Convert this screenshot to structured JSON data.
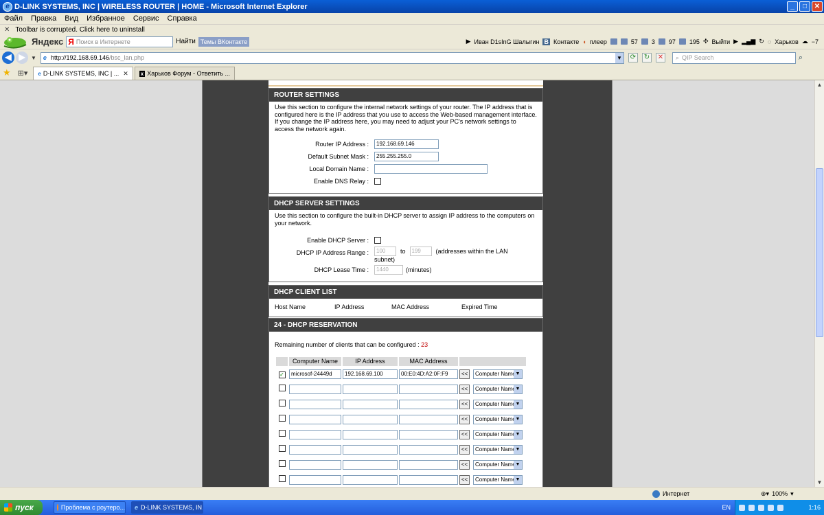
{
  "window": {
    "title": "D-LINK SYSTEMS, INC | WIRELESS ROUTER | HOME - Microsoft Internet Explorer",
    "min": "_",
    "max": "□",
    "close": "✕"
  },
  "menu": [
    "Файл",
    "Правка",
    "Вид",
    "Избранное",
    "Сервис",
    "Справка"
  ],
  "notice": {
    "close": "✕",
    "text": "Toolbar is corrupted. Click here to uninstall"
  },
  "yandex": {
    "brand": "Яндекс",
    "search_placeholder": "Поиск в Интернете",
    "find_label": "Найти",
    "vk_topics": "Темы ВКонтакте",
    "user": "Иван D1sInG Шалыгин",
    "vk_label": "Контакте",
    "player": "плеер",
    "count1": "57",
    "count2": "3",
    "count3": "97",
    "count4": "195",
    "exit": "Выйти",
    "city": "Харьков",
    "temp": "−7"
  },
  "address": {
    "host": "http://192.168.69.146",
    "path": "/bsc_lan.php",
    "qip_placeholder": "QIP Search"
  },
  "tabs": [
    {
      "label": "D-LINK SYSTEMS, INC | ...",
      "active": true
    },
    {
      "label": "Харьков Форум - Ответить ...",
      "active": false
    }
  ],
  "router": {
    "heading": "ROUTER SETTINGS",
    "desc": "Use this section to configure the internal network settings of your router. The IP address that is configured here is the IP address that you use to access the Web-based management interface. If you change the IP address here, you may need to adjust your PC's network settings to access the network again.",
    "ip_label": "Router IP Address :",
    "ip_value": "192.168.69.146",
    "mask_label": "Default Subnet Mask :",
    "mask_value": "255.255.255.0",
    "domain_label": "Local Domain Name :",
    "domain_value": "",
    "dns_label": "Enable DNS Relay :",
    "dns_checked": false
  },
  "dhcp": {
    "heading": "DHCP SERVER SETTINGS",
    "desc": "Use this section to configure the built-in DHCP server to assign IP address to the computers on your network.",
    "enable_label": "Enable DHCP Server :",
    "range_label": "DHCP IP Address Range :",
    "range_from": "100",
    "range_to_word": "to",
    "range_to": "199",
    "range_note": "(addresses within the LAN",
    "range_note2": "subnet)",
    "lease_label": "DHCP Lease Time :",
    "lease_value": "1440",
    "lease_unit": "(minutes)"
  },
  "clients": {
    "heading": "DHCP CLIENT LIST",
    "columns": [
      "Host Name",
      "IP Address",
      "MAC Address",
      "Expired Time"
    ]
  },
  "reservation": {
    "heading": "24 - DHCP RESERVATION",
    "remaining_label": "Remaining number of clients that can be configured :",
    "remaining_value": "23",
    "columns": [
      "Computer Name",
      "IP Address",
      "MAC Address"
    ],
    "copy_btn": "<<",
    "select_value": "Computer Name",
    "rows": [
      {
        "checked": true,
        "name": "microsof-24449d",
        "ip": "192.168.69.100",
        "mac": "00:E0:4D:A2:0F:F9"
      },
      {
        "checked": false,
        "name": "",
        "ip": "",
        "mac": ""
      },
      {
        "checked": false,
        "name": "",
        "ip": "",
        "mac": ""
      },
      {
        "checked": false,
        "name": "",
        "ip": "",
        "mac": ""
      },
      {
        "checked": false,
        "name": "",
        "ip": "",
        "mac": ""
      },
      {
        "checked": false,
        "name": "",
        "ip": "",
        "mac": ""
      },
      {
        "checked": false,
        "name": "",
        "ip": "",
        "mac": ""
      },
      {
        "checked": false,
        "name": "",
        "ip": "",
        "mac": ""
      }
    ]
  },
  "status": {
    "zone": "Интернет",
    "zoom": "100%"
  },
  "taskbar": {
    "start": "пуск",
    "tasks": [
      "Проблема с роутеро...",
      "D-LINK SYSTEMS, IN..."
    ],
    "lang": "EN",
    "clock": "1:16"
  },
  "colors": {
    "accent_red": "#c00000",
    "section_header": "#404040"
  }
}
